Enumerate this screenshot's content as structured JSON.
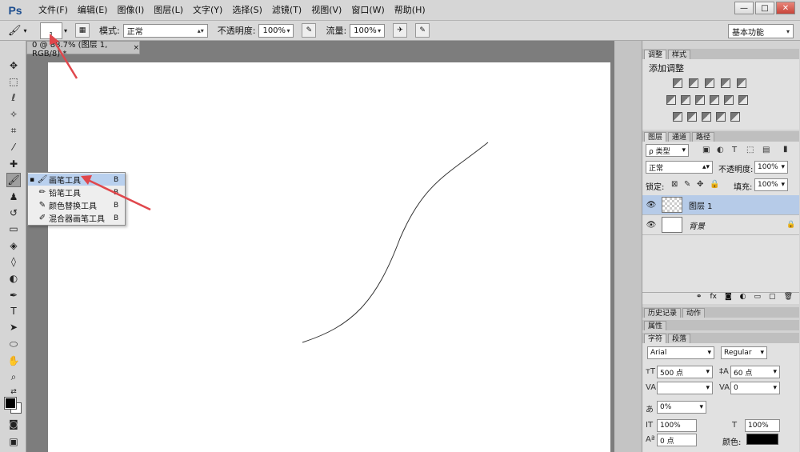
{
  "app": {
    "logo": "Ps"
  },
  "menu": [
    "文件(F)",
    "编辑(E)",
    "图像(I)",
    "图层(L)",
    "文字(Y)",
    "选择(S)",
    "滤镜(T)",
    "视图(V)",
    "窗口(W)",
    "帮助(H)"
  ],
  "window_controls": {
    "minimize": "—",
    "restore": "□",
    "close": "✕"
  },
  "options": {
    "brush_size": "1",
    "mode_label": "模式:",
    "mode_value": "正常",
    "opacity_label": "不透明度:",
    "opacity_value": "100%",
    "flow_label": "流量:",
    "flow_value": "100%",
    "workspace": "基本功能"
  },
  "document": {
    "tab_title": "0 @ 88.7% (图层 1, RGB/8) *",
    "tab_close": "×"
  },
  "tool_flyout": [
    {
      "label": "画笔工具",
      "key": "B",
      "selected": true
    },
    {
      "label": "铅笔工具",
      "key": "B",
      "selected": false
    },
    {
      "label": "颜色替换工具",
      "key": "B",
      "selected": false
    },
    {
      "label": "混合器画笔工具",
      "key": "B",
      "selected": false
    }
  ],
  "adjust_panel": {
    "tabs": [
      "调整",
      "样式"
    ],
    "title": "添加调整"
  },
  "layers_panel": {
    "tabs": [
      "图层",
      "通道",
      "路径"
    ],
    "filter": "ρ 类型",
    "blend": "正常",
    "opacity_label": "不透明度:",
    "opacity_value": "100%",
    "lock_label": "锁定:",
    "fill_label": "填充:",
    "fill_value": "100%",
    "layers": [
      {
        "name": "图层 1",
        "selected": true
      },
      {
        "name": "背景",
        "selected": false,
        "locked": true
      }
    ]
  },
  "history_panel": {
    "tabs": [
      "历史记录",
      "动作"
    ]
  },
  "properties_panel": {
    "title": "属性"
  },
  "character_panel": {
    "tabs": [
      "字符",
      "段落"
    ],
    "font_family": "Arial",
    "font_style": "Regular",
    "font_size": "500 点",
    "leading": "60 点",
    "kerning": "",
    "tracking": "0",
    "scale_percent": "0%",
    "vertical_scale": "100%",
    "horizontal_scale": "100%",
    "baseline": "0 点",
    "color_label": "颜色:",
    "color": "#000000"
  }
}
